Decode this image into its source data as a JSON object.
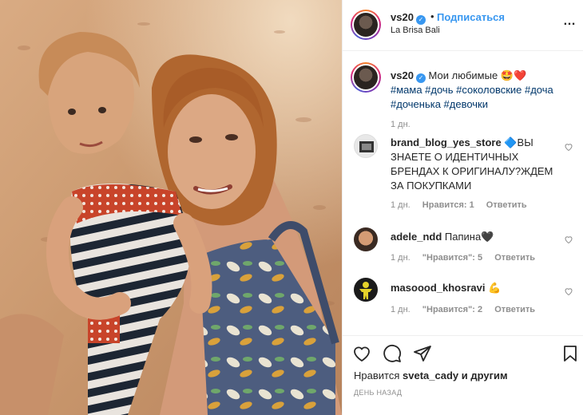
{
  "header": {
    "username": "vs20",
    "dot": "•",
    "follow_label": "Подписаться",
    "location": "La Brisa Bali",
    "more_icon": "…"
  },
  "caption": {
    "username": "vs20",
    "text": "Мои любимые 🤩❤️",
    "hashtags": "#мама #дочь #соколовские #доча #доченька #девочки",
    "time": "1 дн."
  },
  "comments": [
    {
      "username": "brand_blog_yes_store",
      "text": "🔷ВЫ ЗНАЕТЕ О ИДЕНТИЧНЫХ БРЕНДАХ К ОРИГИНАЛУ?ЖДЕМ ЗА ПОКУПКАМИ",
      "time": "1 дн.",
      "likes": "Нравится: 1",
      "reply": "Ответить"
    },
    {
      "username": "adele_ndd",
      "text": "Папина🖤",
      "time": "1 дн.",
      "likes": "\"Нравится\": 5",
      "reply": "Ответить"
    },
    {
      "username": "masoood_khosravi",
      "text": "💪",
      "time": "1 дн.",
      "likes": "\"Нравится\": 2",
      "reply": "Ответить"
    }
  ],
  "footer": {
    "likes_prefix": "Нравится",
    "liked_by": "sveta_cady",
    "likes_suffix": "и другим",
    "date": "ДЕНЬ НАЗАД"
  },
  "icons": {
    "like": "heart-icon",
    "comment": "comment-icon",
    "share": "share-icon",
    "save": "bookmark-icon"
  },
  "colors": {
    "link": "#3897f0",
    "hashtag": "#00376b",
    "muted": "#8e8e8e"
  }
}
